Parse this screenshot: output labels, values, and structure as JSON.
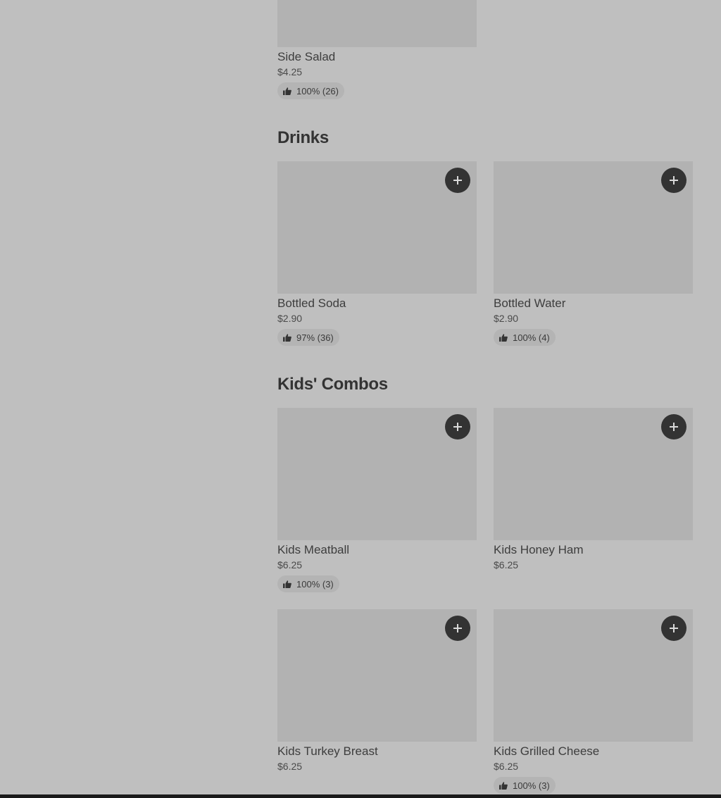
{
  "sections": {
    "top_item": {
      "name": "Side Salad",
      "price": "$4.25",
      "rating": "100% (26)"
    },
    "drinks": {
      "title": "Drinks",
      "items": [
        {
          "name": "Bottled Soda",
          "price": "$2.90",
          "rating": "97% (36)"
        },
        {
          "name": "Bottled Water",
          "price": "$2.90",
          "rating": "100% (4)"
        }
      ]
    },
    "kids_combos": {
      "title": "Kids' Combos",
      "items": [
        {
          "name": "Kids Meatball",
          "price": "$6.25",
          "rating": "100% (3)"
        },
        {
          "name": "Kids Honey Ham",
          "price": "$6.25"
        },
        {
          "name": "Kids Turkey Breast",
          "price": "$6.25"
        },
        {
          "name": "Kids Grilled Cheese",
          "price": "$6.25",
          "rating": "100% (3)"
        }
      ]
    }
  },
  "icons": {
    "add": "plus-icon",
    "rating": "thumbs-up-icon"
  },
  "colors": {
    "page_background": "#bfbfbf",
    "image_placeholder": "#b2b2b2",
    "add_button": "#333333",
    "rating_pill": "#b4b4b4"
  }
}
